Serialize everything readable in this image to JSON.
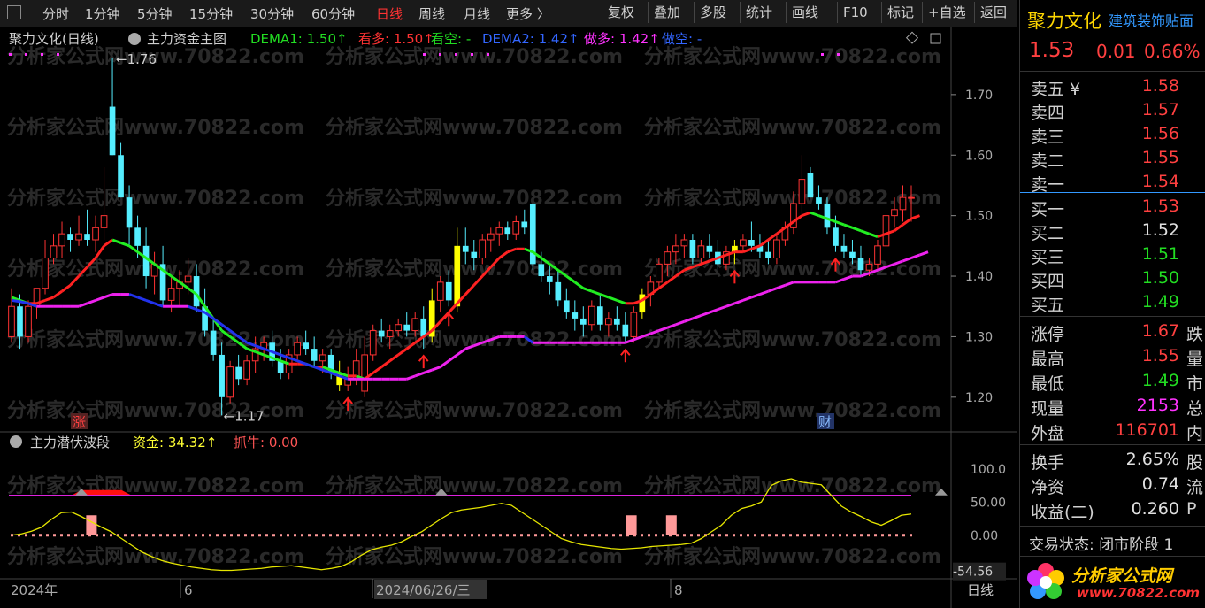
{
  "toolbar": {
    "periods": [
      "分时",
      "1分钟",
      "5分钟",
      "15分钟",
      "30分钟",
      "60分钟",
      "日线",
      "周线",
      "月线",
      "更多 〉"
    ],
    "active": "日线",
    "buttons": [
      "复权",
      "叠加",
      "多股",
      "统计",
      "画线",
      "F10",
      "标记",
      "+自选",
      "返回"
    ]
  },
  "main_header": {
    "stock": "聚力文化(日线)",
    "indicator": "主力资金主图",
    "items": [
      {
        "label": "DEMA1: 1.50↑",
        "color": "#22dd22"
      },
      {
        "label": "看多: 1.50↑",
        "color": "#ff3333"
      },
      {
        "label": "看空: -",
        "color": "#22dd22"
      },
      {
        "label": "DEMA2: 1.42↑",
        "color": "#3366ff"
      },
      {
        "label": "做多: 1.42↑",
        "color": "#ff33ff"
      },
      {
        "label": "做空: -",
        "color": "#3366ff"
      }
    ]
  },
  "main_axis": {
    "ticks": [
      "1.70",
      "1.60",
      "1.50",
      "1.40",
      "1.30",
      "1.20"
    ],
    "values": [
      1.7,
      1.6,
      1.5,
      1.4,
      1.3,
      1.2
    ]
  },
  "annotations": {
    "high": "1.76",
    "low": "1.17",
    "zhang": "涨",
    "cai": "财"
  },
  "watermark": "分析家公式网www.70822.com",
  "sub_header": {
    "indicator": "主力潜伏波段",
    "zijin": "资金: 34.32↑",
    "zhuaniu": "抓牛: 0.00"
  },
  "sub_axis": {
    "ticks": [
      "100.0",
      "50.00",
      "0.00",
      "-54.56"
    ],
    "values": [
      100,
      50,
      0,
      -54.56
    ]
  },
  "date_axis": {
    "labels": [
      "2024年",
      "6",
      "2024/06/26/三",
      "8"
    ],
    "period": "日线"
  },
  "right_panel": {
    "name": "聚力文化",
    "industry": "建筑装饰贴面",
    "price": "1.53",
    "change": "0.01",
    "pct": "0.66%",
    "asks": [
      {
        "label": "卖五 ¥",
        "price": "1.58"
      },
      {
        "label": "卖四",
        "price": "1.57"
      },
      {
        "label": "卖三",
        "price": "1.56"
      },
      {
        "label": "卖二",
        "price": "1.55"
      },
      {
        "label": "卖一",
        "price": "1.54"
      }
    ],
    "bids": [
      {
        "label": "买一",
        "price": "1.53",
        "color": "#ff4040"
      },
      {
        "label": "买二",
        "price": "1.52",
        "color": "#e0e0e0"
      },
      {
        "label": "买三",
        "price": "1.51",
        "color": "#22dd22"
      },
      {
        "label": "买四",
        "price": "1.50",
        "color": "#22dd22"
      },
      {
        "label": "买五",
        "price": "1.49",
        "color": "#22dd22"
      }
    ],
    "stats1": [
      {
        "label": "涨停",
        "value": "1.67",
        "color": "#ff4040",
        "tail": "跌"
      },
      {
        "label": "最高",
        "value": "1.55",
        "color": "#ff4040",
        "tail": "量"
      },
      {
        "label": "最低",
        "value": "1.49",
        "color": "#22dd22",
        "tail": "市"
      },
      {
        "label": "现量",
        "value": "2153",
        "color": "#ff33ff",
        "tail": "总"
      },
      {
        "label": "外盘",
        "value": "116701",
        "color": "#ff4040",
        "tail": "内"
      }
    ],
    "stats2": [
      {
        "label": "换手",
        "value": "2.65%",
        "color": "#e0e0e0",
        "tail": "股"
      },
      {
        "label": "净资",
        "value": "0.74",
        "color": "#e0e0e0",
        "tail": "流"
      },
      {
        "label": "收益(二)",
        "value": "0.260",
        "color": "#e0e0e0",
        "tail": "P"
      }
    ],
    "trade_status": "交易状态: 闭市阶段 1",
    "logo_text": "分析家公式网",
    "logo_url": "www.70822.com"
  },
  "chart_data": {
    "type": "candlestick",
    "title": "聚力文化(日线)",
    "ylim": [
      1.15,
      1.77
    ],
    "candles": [
      [
        1.3,
        1.38,
        1.29,
        1.35
      ],
      [
        1.35,
        1.37,
        1.28,
        1.3
      ],
      [
        1.3,
        1.36,
        1.29,
        1.35
      ],
      [
        1.35,
        1.38,
        1.33,
        1.38
      ],
      [
        1.38,
        1.46,
        1.37,
        1.43
      ],
      [
        1.43,
        1.47,
        1.42,
        1.45
      ],
      [
        1.45,
        1.49,
        1.43,
        1.47
      ],
      [
        1.47,
        1.48,
        1.44,
        1.46
      ],
      [
        1.46,
        1.5,
        1.45,
        1.47
      ],
      [
        1.47,
        1.51,
        1.45,
        1.46
      ],
      [
        1.46,
        1.5,
        1.44,
        1.48
      ],
      [
        1.48,
        1.58,
        1.46,
        1.5
      ],
      [
        1.68,
        1.76,
        1.6,
        1.6
      ],
      [
        1.6,
        1.62,
        1.53,
        1.53
      ],
      [
        1.53,
        1.55,
        1.45,
        1.48
      ],
      [
        1.48,
        1.5,
        1.43,
        1.45
      ],
      [
        1.45,
        1.48,
        1.38,
        1.4
      ],
      [
        1.4,
        1.44,
        1.37,
        1.42
      ],
      [
        1.42,
        1.45,
        1.35,
        1.36
      ],
      [
        1.36,
        1.4,
        1.34,
        1.38
      ],
      [
        1.38,
        1.41,
        1.35,
        1.39
      ],
      [
        1.39,
        1.43,
        1.37,
        1.4
      ],
      [
        1.4,
        1.42,
        1.34,
        1.35
      ],
      [
        1.35,
        1.38,
        1.3,
        1.31
      ],
      [
        1.31,
        1.33,
        1.26,
        1.27
      ],
      [
        1.27,
        1.29,
        1.17,
        1.2
      ],
      [
        1.2,
        1.26,
        1.19,
        1.25
      ],
      [
        1.25,
        1.27,
        1.22,
        1.23
      ],
      [
        1.23,
        1.27,
        1.22,
        1.26
      ],
      [
        1.26,
        1.3,
        1.24,
        1.28
      ],
      [
        1.28,
        1.3,
        1.26,
        1.29
      ],
      [
        1.29,
        1.31,
        1.25,
        1.26
      ],
      [
        1.26,
        1.28,
        1.23,
        1.24
      ],
      [
        1.24,
        1.28,
        1.23,
        1.27
      ],
      [
        1.27,
        1.3,
        1.26,
        1.29
      ],
      [
        1.29,
        1.31,
        1.27,
        1.28
      ],
      [
        1.28,
        1.3,
        1.25,
        1.26
      ],
      [
        1.26,
        1.28,
        1.24,
        1.27
      ],
      [
        1.27,
        1.28,
        1.23,
        1.24
      ],
      [
        1.24,
        1.26,
        1.21,
        1.22
      ],
      [
        1.22,
        1.25,
        1.21,
        1.23
      ],
      [
        1.23,
        1.28,
        1.22,
        1.26
      ],
      [
        1.21,
        1.3,
        1.2,
        1.27
      ],
      [
        1.27,
        1.32,
        1.26,
        1.31
      ],
      [
        1.31,
        1.33,
        1.29,
        1.3
      ],
      [
        1.3,
        1.32,
        1.28,
        1.31
      ],
      [
        1.31,
        1.33,
        1.3,
        1.32
      ],
      [
        1.32,
        1.34,
        1.3,
        1.31
      ],
      [
        1.31,
        1.34,
        1.3,
        1.33
      ],
      [
        1.33,
        1.35,
        1.28,
        1.3
      ],
      [
        1.3,
        1.38,
        1.29,
        1.36
      ],
      [
        1.36,
        1.4,
        1.34,
        1.39
      ],
      [
        1.39,
        1.41,
        1.35,
        1.36
      ],
      [
        1.35,
        1.48,
        1.34,
        1.45
      ],
      [
        1.45,
        1.48,
        1.42,
        1.44
      ],
      [
        1.44,
        1.46,
        1.41,
        1.43
      ],
      [
        1.43,
        1.47,
        1.42,
        1.46
      ],
      [
        1.46,
        1.48,
        1.44,
        1.47
      ],
      [
        1.47,
        1.49,
        1.45,
        1.48
      ],
      [
        1.48,
        1.49,
        1.46,
        1.47
      ],
      [
        1.47,
        1.5,
        1.46,
        1.49
      ],
      [
        1.49,
        1.51,
        1.47,
        1.48
      ],
      [
        1.52,
        1.52,
        1.41,
        1.42
      ],
      [
        1.42,
        1.44,
        1.39,
        1.4
      ],
      [
        1.4,
        1.42,
        1.37,
        1.39
      ],
      [
        1.39,
        1.41,
        1.35,
        1.36
      ],
      [
        1.36,
        1.38,
        1.33,
        1.34
      ],
      [
        1.34,
        1.36,
        1.31,
        1.33
      ],
      [
        1.33,
        1.35,
        1.3,
        1.32
      ],
      [
        1.32,
        1.36,
        1.31,
        1.35
      ],
      [
        1.35,
        1.37,
        1.31,
        1.32
      ],
      [
        1.32,
        1.34,
        1.3,
        1.33
      ],
      [
        1.33,
        1.35,
        1.31,
        1.32
      ],
      [
        1.32,
        1.34,
        1.29,
        1.3
      ],
      [
        1.3,
        1.35,
        1.29,
        1.34
      ],
      [
        1.34,
        1.38,
        1.33,
        1.37
      ],
      [
        1.37,
        1.4,
        1.35,
        1.39
      ],
      [
        1.39,
        1.43,
        1.38,
        1.42
      ],
      [
        1.42,
        1.45,
        1.4,
        1.44
      ],
      [
        1.44,
        1.47,
        1.42,
        1.45
      ],
      [
        1.45,
        1.47,
        1.43,
        1.46
      ],
      [
        1.46,
        1.47,
        1.42,
        1.43
      ],
      [
        1.43,
        1.46,
        1.42,
        1.45
      ],
      [
        1.45,
        1.47,
        1.43,
        1.44
      ],
      [
        1.44,
        1.46,
        1.41,
        1.42
      ],
      [
        1.42,
        1.45,
        1.41,
        1.44
      ],
      [
        1.44,
        1.46,
        1.42,
        1.45
      ],
      [
        1.45,
        1.47,
        1.44,
        1.46
      ],
      [
        1.46,
        1.49,
        1.44,
        1.45
      ],
      [
        1.45,
        1.47,
        1.43,
        1.44
      ],
      [
        1.44,
        1.46,
        1.42,
        1.43
      ],
      [
        1.43,
        1.47,
        1.42,
        1.46
      ],
      [
        1.46,
        1.49,
        1.45,
        1.48
      ],
      [
        1.48,
        1.54,
        1.47,
        1.52
      ],
      [
        1.52,
        1.6,
        1.5,
        1.56
      ],
      [
        1.57,
        1.58,
        1.53,
        1.53
      ],
      [
        1.53,
        1.55,
        1.51,
        1.52
      ],
      [
        1.52,
        1.53,
        1.47,
        1.48
      ],
      [
        1.48,
        1.5,
        1.44,
        1.45
      ],
      [
        1.45,
        1.47,
        1.43,
        1.44
      ],
      [
        1.44,
        1.46,
        1.42,
        1.43
      ],
      [
        1.43,
        1.45,
        1.4,
        1.41
      ],
      [
        1.41,
        1.43,
        1.4,
        1.42
      ],
      [
        1.42,
        1.46,
        1.41,
        1.45
      ],
      [
        1.45,
        1.51,
        1.44,
        1.5
      ],
      [
        1.5,
        1.53,
        1.48,
        1.51
      ],
      [
        1.51,
        1.55,
        1.49,
        1.53
      ],
      [
        1.53,
        1.55,
        1.49,
        1.53
      ]
    ],
    "signal_bars": [
      39,
      50,
      53,
      75,
      86
    ],
    "sell_arrows": [
      40,
      49,
      52,
      73,
      86,
      98,
      110
    ],
    "dema1": [
      1.365,
      1.36,
      1.355,
      1.355,
      1.36,
      1.365,
      1.375,
      1.385,
      1.4,
      1.415,
      1.43,
      1.45,
      1.46,
      1.455,
      1.45,
      1.44,
      1.43,
      1.42,
      1.41,
      1.4,
      1.39,
      1.38,
      1.37,
      1.35,
      1.33,
      1.31,
      1.3,
      1.29,
      1.28,
      1.275,
      1.27,
      1.265,
      1.26,
      1.255,
      1.255,
      1.255,
      1.25,
      1.25,
      1.245,
      1.24,
      1.235,
      1.235,
      1.23,
      1.24,
      1.25,
      1.26,
      1.27,
      1.28,
      1.29,
      1.3,
      1.31,
      1.325,
      1.34,
      1.355,
      1.37,
      1.385,
      1.4,
      1.415,
      1.43,
      1.44,
      1.445,
      1.445,
      1.44,
      1.43,
      1.42,
      1.41,
      1.4,
      1.39,
      1.38,
      1.375,
      1.37,
      1.365,
      1.36,
      1.355,
      1.355,
      1.36,
      1.37,
      1.38,
      1.39,
      1.4,
      1.41,
      1.415,
      1.42,
      1.425,
      1.43,
      1.435,
      1.44,
      1.44,
      1.445,
      1.45,
      1.46,
      1.47,
      1.48,
      1.49,
      1.5,
      1.505,
      1.5,
      1.495,
      1.49,
      1.485,
      1.48,
      1.475,
      1.47,
      1.465,
      1.47,
      1.475,
      1.485,
      1.495,
      1.5
    ],
    "dema2": [
      1.36,
      1.358,
      1.355,
      1.35,
      1.35,
      1.35,
      1.35,
      1.35,
      1.35,
      1.355,
      1.36,
      1.365,
      1.37,
      1.37,
      1.37,
      1.365,
      1.36,
      1.355,
      1.35,
      1.35,
      1.35,
      1.35,
      1.345,
      1.34,
      1.33,
      1.32,
      1.31,
      1.3,
      1.29,
      1.285,
      1.28,
      1.275,
      1.27,
      1.265,
      1.26,
      1.255,
      1.25,
      1.245,
      1.24,
      1.235,
      1.23,
      1.23,
      1.23,
      1.23,
      1.23,
      1.23,
      1.23,
      1.23,
      1.235,
      1.24,
      1.245,
      1.25,
      1.26,
      1.27,
      1.28,
      1.285,
      1.29,
      1.295,
      1.3,
      1.3,
      1.3,
      1.3,
      1.29,
      1.29,
      1.29,
      1.29,
      1.29,
      1.29,
      1.29,
      1.29,
      1.29,
      1.29,
      1.29,
      1.29,
      1.295,
      1.3,
      1.305,
      1.31,
      1.315,
      1.32,
      1.325,
      1.33,
      1.335,
      1.34,
      1.345,
      1.35,
      1.355,
      1.36,
      1.365,
      1.37,
      1.375,
      1.38,
      1.385,
      1.39,
      1.39,
      1.39,
      1.39,
      1.39,
      1.39,
      1.395,
      1.4,
      1.4,
      1.405,
      1.41,
      1.415,
      1.42,
      1.425,
      1.43,
      1.435,
      1.44
    ],
    "sub": {
      "ylim": [
        -75,
        125
      ],
      "line": [
        0,
        2,
        6,
        12,
        24,
        34,
        35,
        28,
        20,
        12,
        5,
        -5,
        -15,
        -25,
        -32,
        -38,
        -42,
        -45,
        -48,
        -50,
        -52,
        -53,
        -53,
        -52,
        -51,
        -50,
        -48,
        -47,
        -46,
        -48,
        -50,
        -52,
        -50,
        -47,
        -40,
        -30,
        -22,
        -18,
        -15,
        -10,
        -2,
        5,
        15,
        25,
        34,
        38,
        40,
        42,
        45,
        48,
        45,
        35,
        25,
        15,
        5,
        -5,
        -10,
        -14,
        -16,
        -18,
        -20,
        -21,
        -20,
        -19,
        -17,
        -16,
        -15,
        -14,
        -12,
        -5,
        5,
        15,
        30,
        40,
        44,
        50,
        75,
        82,
        85,
        80,
        78,
        76,
        60,
        44,
        35,
        28,
        20,
        15,
        22,
        30,
        32
      ],
      "pink_bars": [
        8,
        62,
        66,
        107
      ],
      "red_area_start": 107,
      "line_level": 60,
      "dot_level": 0
    }
  }
}
